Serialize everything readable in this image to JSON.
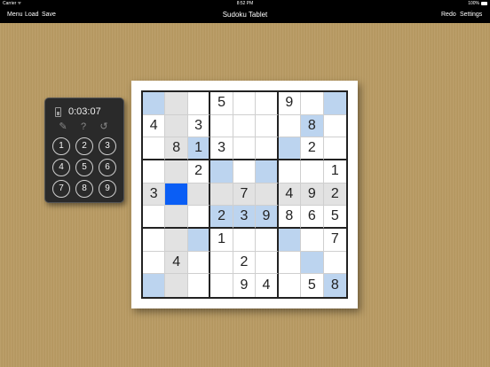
{
  "statusbar": {
    "carrier": "Carrier ᯤ",
    "time": "8:52 PM",
    "battery": "100%"
  },
  "navbar": {
    "menu": "Menu",
    "load": "Load",
    "save": "Save",
    "title": "Sudoku Tablet",
    "redo": "Redo",
    "settings": "Settings"
  },
  "panel": {
    "timer": "0:03:07",
    "tools": [
      {
        "name": "pencil",
        "glyph": "✎"
      },
      {
        "name": "hint",
        "glyph": "?"
      },
      {
        "name": "undo",
        "glyph": "↺"
      }
    ],
    "numbers": [
      "1",
      "2",
      "3",
      "4",
      "5",
      "6",
      "7",
      "8",
      "9"
    ]
  },
  "colors": {
    "selected": "#0a5ef5",
    "highlight": "#bcd4ef",
    "peer": "#e2e2e2"
  },
  "board": {
    "rows": [
      [
        "",
        "",
        "",
        "5",
        "",
        "",
        "9",
        "",
        ""
      ],
      [
        "4",
        "",
        "3",
        "",
        "",
        "",
        "",
        "8",
        ""
      ],
      [
        "",
        "8",
        "1",
        "3",
        "",
        "",
        "",
        "2",
        ""
      ],
      [
        "",
        "",
        "2",
        "",
        "",
        "",
        "",
        "",
        "1"
      ],
      [
        "3",
        "",
        "",
        "",
        "7",
        "",
        "4",
        "9",
        "2"
      ],
      [
        "",
        "",
        "",
        "2",
        "3",
        "9",
        "8",
        "6",
        "5"
      ],
      [
        "",
        "",
        "",
        "1",
        "",
        "",
        "",
        "",
        "7"
      ],
      [
        "",
        "4",
        "",
        "",
        "2",
        "",
        "",
        "",
        ""
      ],
      [
        "",
        "",
        "",
        "",
        "9",
        "4",
        "",
        "5",
        "8"
      ]
    ],
    "shading": [
      [
        "b",
        "g",
        "",
        "",
        "",
        "",
        "",
        "",
        "b"
      ],
      [
        "",
        "g",
        "",
        "",
        "",
        "",
        "",
        "b",
        ""
      ],
      [
        "",
        "g",
        "b",
        "",
        "",
        "",
        "b",
        "",
        ""
      ],
      [
        "",
        "g",
        "",
        "b",
        "",
        "b",
        "",
        "",
        ""
      ],
      [
        "g",
        "s",
        "g",
        "g",
        "g",
        "g",
        "g",
        "g",
        "g"
      ],
      [
        "",
        "g",
        "",
        "b",
        "b",
        "b",
        "",
        "",
        ""
      ],
      [
        "",
        "g",
        "b",
        "",
        "",
        "",
        "b",
        "",
        ""
      ],
      [
        "",
        "g",
        "",
        "",
        "",
        "",
        "",
        "b",
        ""
      ],
      [
        "b",
        "g",
        "",
        "",
        "",
        "",
        "",
        "",
        "b"
      ]
    ]
  }
}
